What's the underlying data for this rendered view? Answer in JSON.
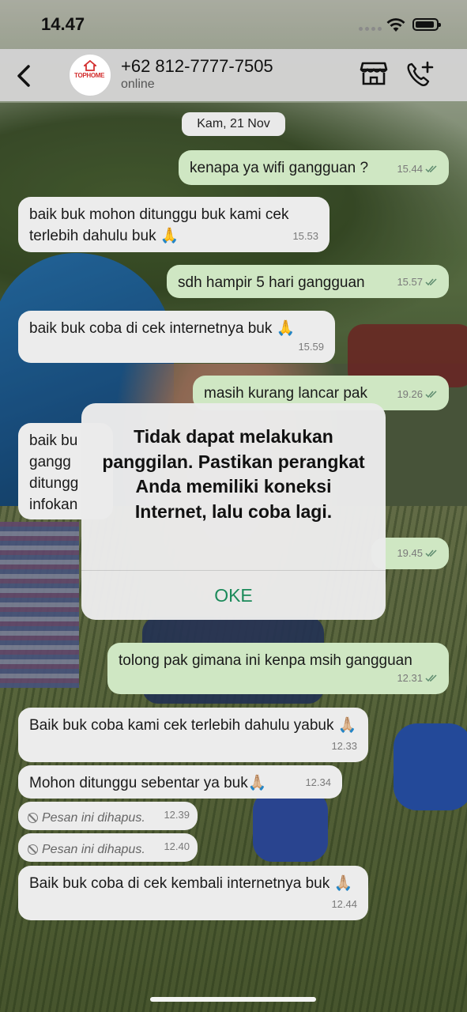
{
  "status_bar": {
    "time": "14.47",
    "battery_level": 0.92
  },
  "header": {
    "contact_name": "+62 812-7777-7505",
    "contact_status": "online",
    "avatar_logo_text": "TOPHOME",
    "icons": [
      "back-chevron-icon",
      "store-icon",
      "add-call-icon"
    ]
  },
  "chat": {
    "date_separator": "Kam, 21 Nov",
    "messages": [
      {
        "dir": "out",
        "text": "kenapa ya wifi gangguan ?",
        "time": "15.44",
        "read": true
      },
      {
        "dir": "in",
        "text": "baik buk mohon ditunggu buk kami cek terlebih dahulu buk 🙏",
        "time": "15.53"
      },
      {
        "dir": "out",
        "text": "sdh hampir 5 hari gangguan",
        "time": "15.57",
        "read": true
      },
      {
        "dir": "in",
        "text": "baik buk coba di cek internetnya buk 🙏",
        "time": "15.59"
      },
      {
        "dir": "out",
        "text": "masih kurang lancar pak",
        "time": "19.26",
        "read": true
      },
      {
        "dir": "in",
        "text": "baik bu\ngangg\nditungg\ninfokan",
        "time": ""
      },
      {
        "dir": "out",
        "text": "",
        "time": "19.45",
        "read": true
      },
      {
        "dir": "out",
        "text": "tolong pak gimana ini kenpa msih gangguan",
        "time": "12.31",
        "read": true
      },
      {
        "dir": "in",
        "text": "Baik buk coba kami cek terlebih dahulu yabuk 🙏🏼",
        "time": "12.33"
      },
      {
        "dir": "in",
        "text": "Mohon ditunggu sebentar ya buk🙏🏼",
        "time": "12.34"
      },
      {
        "dir": "in",
        "deleted": true,
        "text": "Pesan ini dihapus.",
        "time": "12.39"
      },
      {
        "dir": "in",
        "deleted": true,
        "text": "Pesan ini dihapus.",
        "time": "12.40"
      },
      {
        "dir": "in",
        "text": "Baik buk coba di cek kembali internetnya buk 🙏🏼",
        "time": "12.44"
      }
    ]
  },
  "alert": {
    "message": "Tidak dapat melakukan panggilan. Pastikan perangkat Anda memiliki koneksi Internet, lalu coba lagi.",
    "button_label": "OKE"
  },
  "colors": {
    "outgoing_bubble": "#cfe7c3",
    "incoming_bubble": "#ececec",
    "alert_button": "#1b8a5a",
    "read_ticks": "#5f8c6f"
  }
}
